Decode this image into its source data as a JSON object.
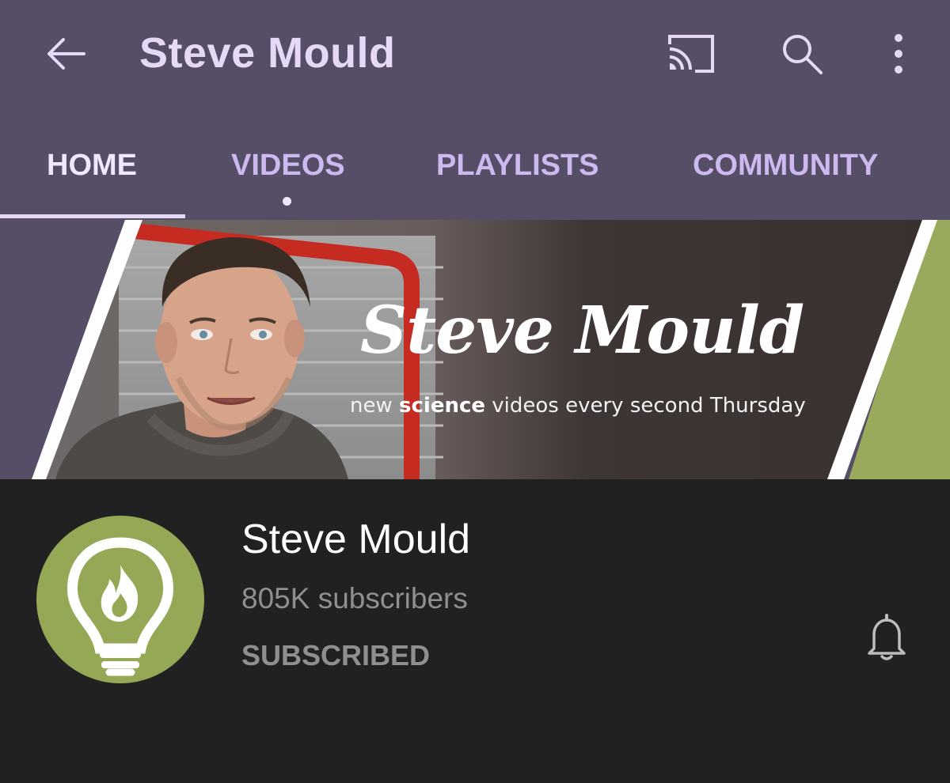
{
  "appbar": {
    "title": "Steve Mould",
    "icons": {
      "back": "arrow-left-icon",
      "cast": "cast-icon",
      "search": "search-icon",
      "more": "more-vert-icon"
    }
  },
  "tabs": [
    {
      "label": "HOME",
      "active": true
    },
    {
      "label": "VIDEOS",
      "has_new_dot": true
    },
    {
      "label": "PLAYLISTS"
    },
    {
      "label": "COMMUNITY"
    }
  ],
  "banner": {
    "title": "Steve Mould",
    "tagline_pre": "new ",
    "tagline_bold": "science",
    "tagline_post": " videos every second Thursday"
  },
  "channel": {
    "name": "Steve Mould",
    "subscribers": "805K subscribers",
    "subscribe_state": "SUBSCRIBED",
    "avatar_icon": "lightbulb-flame-icon",
    "bell_icon": "bell-icon"
  },
  "colors": {
    "appbar_bg": "#564d66",
    "tab_text": "#cdb9ef",
    "active_tab_text": "#f1e9fb",
    "page_bg": "#212121",
    "avatar_bg": "#94a855",
    "banner_green": "#9aaa5c"
  }
}
